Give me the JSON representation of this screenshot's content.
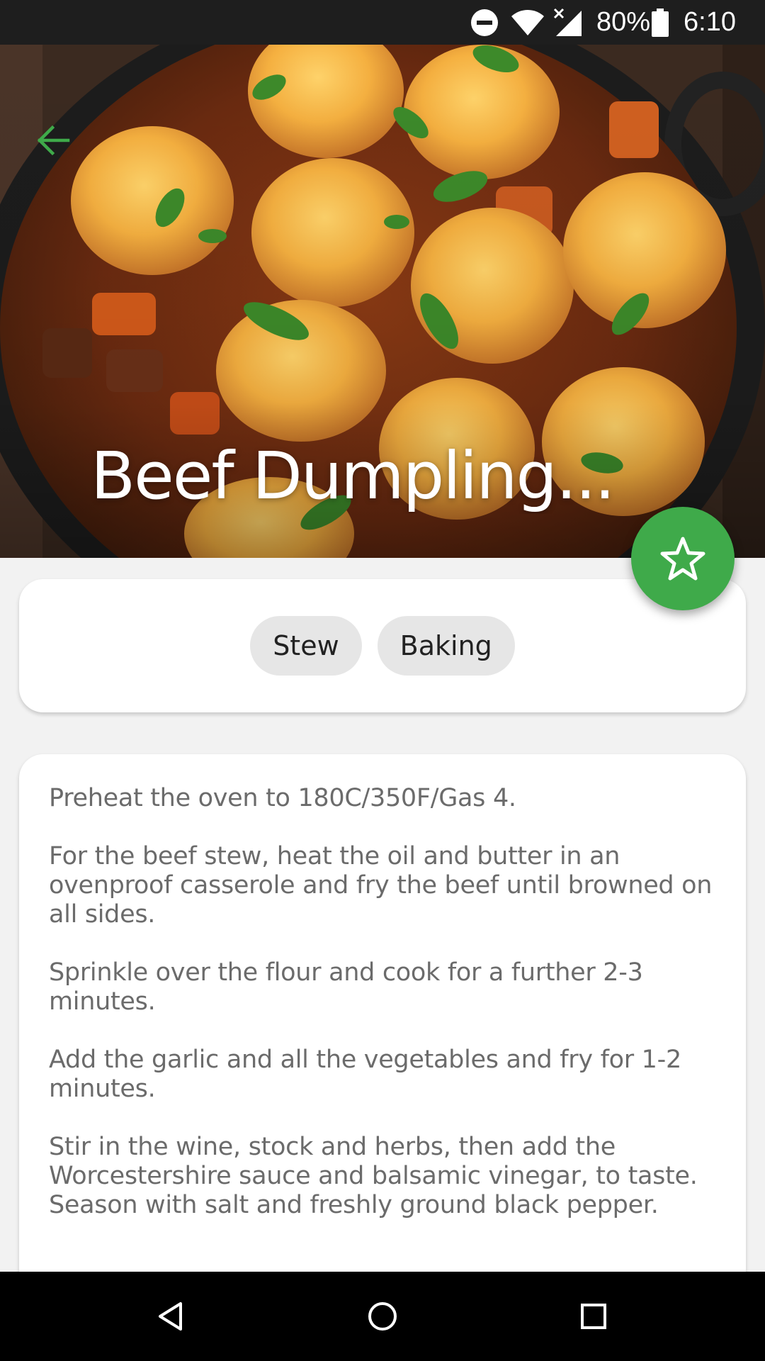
{
  "status_bar": {
    "battery_percent": "80%",
    "time": "6:10",
    "icons": [
      "do-not-disturb-icon",
      "wifi-icon",
      "cell-signal-icon",
      "battery-icon"
    ]
  },
  "hero": {
    "title": "Beef Dumpling...",
    "back_icon": "arrow-left-icon",
    "image": "beef-dumpling-stew-photo"
  },
  "favorite_button": {
    "icon": "star-outline-icon"
  },
  "tags": [
    "Stew",
    "Baking"
  ],
  "instructions": [
    "Preheat the oven to 180C/350F/Gas 4.",
    "For the beef stew, heat the oil and butter in an ovenproof casserole and fry the beef until browned on all sides.",
    "Sprinkle over the flour and cook for a further 2-3 minutes.",
    "Add the garlic and all the vegetables and fry for 1-2 minutes.",
    "Stir in the wine, stock and herbs, then add the Worcestershire sauce and balsamic vinegar, to taste. Season with salt and freshly ground black pepper."
  ],
  "nav_bar": {
    "icons": [
      "back-triangle-icon",
      "home-circle-icon",
      "recents-square-icon"
    ]
  },
  "colors": {
    "accent": "#3faa4a",
    "chip_background": "#e6e6e6",
    "status_bar": "#1e1e1e",
    "nav_bar": "#000000",
    "body_text": "#6b6b6b"
  }
}
